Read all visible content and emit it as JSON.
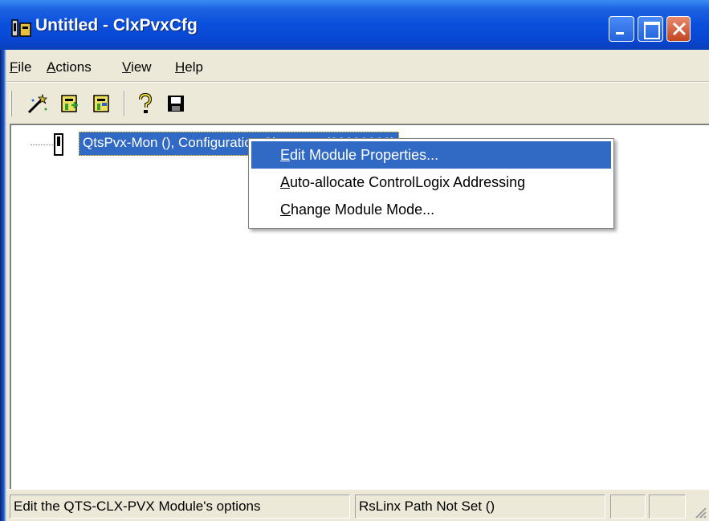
{
  "window": {
    "title": "Untitled - ClxPvxCfg",
    "app_icon": "module-icon",
    "controls": [
      "minimize-icon",
      "maximize-icon",
      "close-icon"
    ]
  },
  "menu": {
    "items": [
      {
        "label_ul": "F",
        "label_rest": "ile"
      },
      {
        "label_ul": "A",
        "label_rest": "ctions"
      },
      {
        "label_ul": "V",
        "label_rest": "iew"
      },
      {
        "label_ul": "H",
        "label_rest": "elp"
      }
    ]
  },
  "toolbar": {
    "tools": [
      "wizard-icon",
      "module-add-icon",
      "module-edit-icon",
      "help-icon",
      "save-icon"
    ]
  },
  "tree": {
    "node_label": "QtsPvx-Mon (), Configuration Signature (00000000)"
  },
  "context_menu": {
    "items": [
      {
        "ul": "E",
        "rest": "dit Module Properties...",
        "selected": true
      },
      {
        "ul": "A",
        "rest": "uto-allocate ControlLogix Addressing",
        "selected": false
      },
      {
        "ul": "C",
        "rest": "hange Module Mode...",
        "selected": false
      }
    ]
  },
  "status": {
    "message": "Edit the QTS-CLX-PVX Module's options",
    "path": "RsLinx Path Not Set ()",
    "pane3": "",
    "pane4": ""
  },
  "colors": {
    "selection": "#316AC5",
    "titlebar": "#0846d2",
    "face": "#ECE9D8"
  }
}
